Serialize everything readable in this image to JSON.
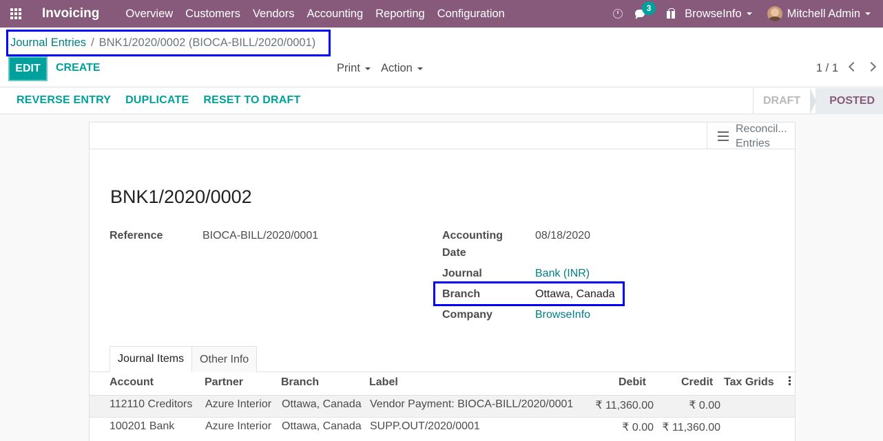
{
  "navbar": {
    "app_name": "Invoicing",
    "menu": [
      "Overview",
      "Customers",
      "Vendors",
      "Accounting",
      "Reporting",
      "Configuration"
    ],
    "messages_count": "3",
    "company": "BrowseInfo",
    "user": "Mitchell Admin"
  },
  "breadcrumb": {
    "parent": "Journal Entries",
    "separator": "/",
    "current": "BNK1/2020/0002 (BIOCA-BILL/2020/0001)"
  },
  "toolbar": {
    "edit_label": "EDIT",
    "create_label": "CREATE",
    "print_label": "Print",
    "action_label": "Action",
    "pager": "1 / 1"
  },
  "statusbar": {
    "actions": [
      "REVERSE ENTRY",
      "DUPLICATE",
      "RESET TO DRAFT"
    ],
    "steps": [
      "DRAFT",
      "POSTED"
    ],
    "active_step": "POSTED"
  },
  "smart_button": {
    "line1": "Reconcil...",
    "line2": "Entries"
  },
  "record": {
    "title": "BNK1/2020/0002",
    "reference_label": "Reference",
    "reference": "BIOCA-BILL/2020/0001",
    "accounting_date_label_1": "Accounting",
    "accounting_date_label_2": "Date",
    "accounting_date": "08/18/2020",
    "journal_label": "Journal",
    "journal": "Bank (INR)",
    "branch_label": "Branch",
    "branch": "Ottawa, Canada",
    "company_label": "Company",
    "company": "BrowseInfo"
  },
  "tabs": [
    "Journal Items",
    "Other Info"
  ],
  "journal_items": {
    "columns": [
      "Account",
      "Partner",
      "Branch",
      "Label",
      "Debit",
      "Credit",
      "Tax Grids"
    ],
    "rows": [
      {
        "account": "112110 Creditors",
        "partner": "Azure Interior",
        "branch": "Ottawa, Canada",
        "label": "Vendor Payment: BIOCA-BILL/2020/0001",
        "debit": "₹ 11,360.00",
        "credit": "₹ 0.00",
        "tax_grids": ""
      },
      {
        "account": "100201 Bank",
        "partner": "Azure Interior",
        "branch": "Ottawa, Canada",
        "label": "SUPP.OUT/2020/0001",
        "debit": "₹ 0.00",
        "credit": "₹ 11,360.00",
        "tax_grids": ""
      }
    ]
  },
  "colors": {
    "navbar": "#875a7b",
    "primary": "#00a09d",
    "link": "#017e84",
    "highlight_box": "#0000ff"
  }
}
